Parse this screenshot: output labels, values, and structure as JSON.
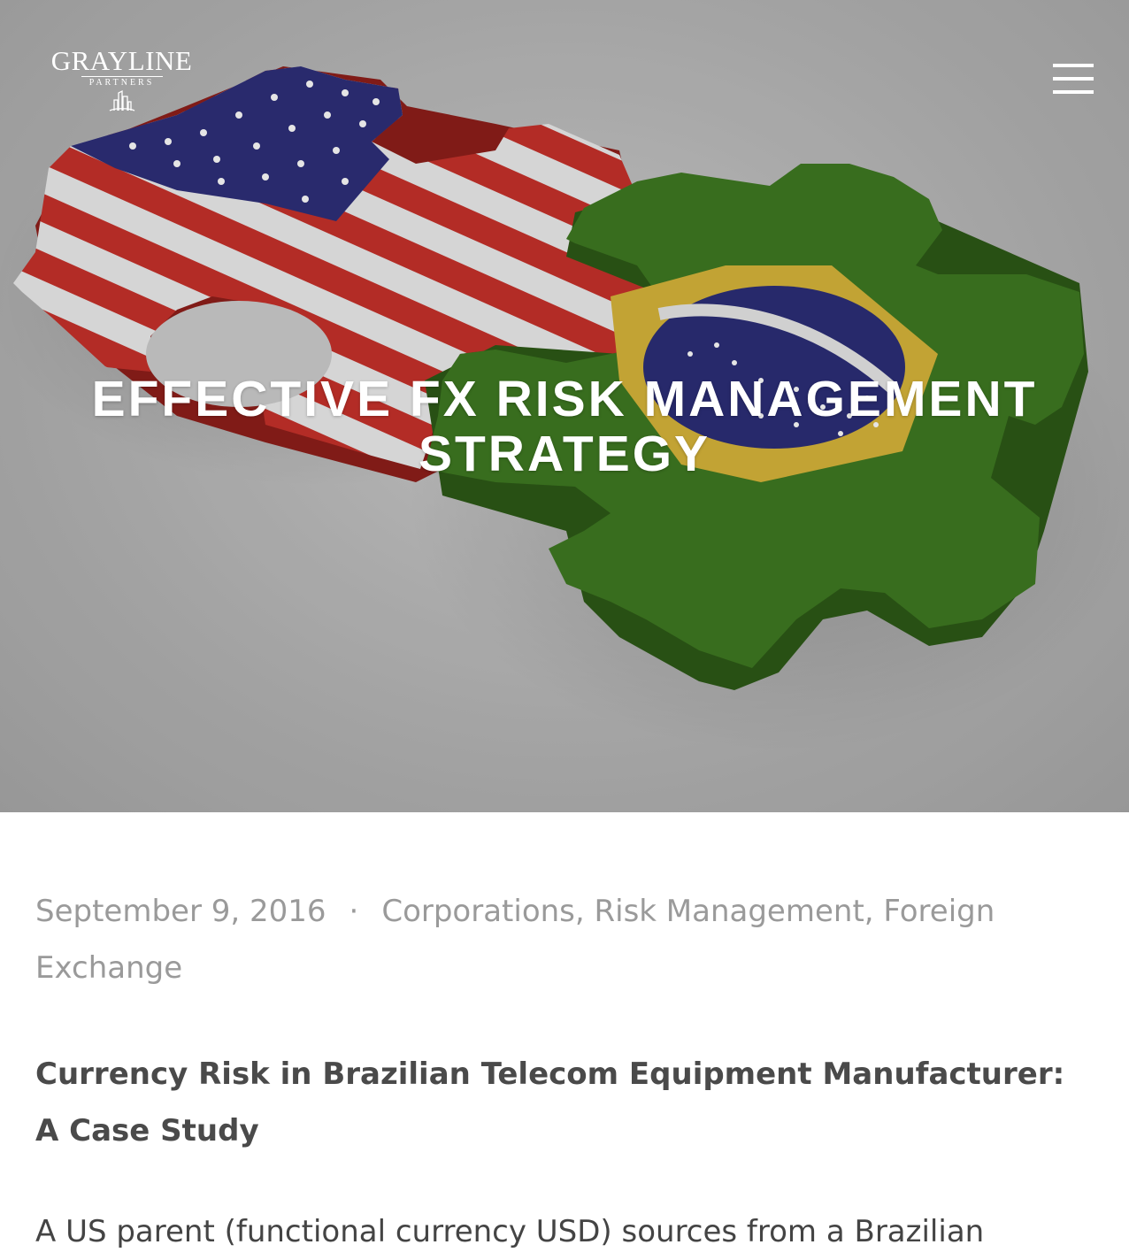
{
  "header": {
    "logo": {
      "name": "GRAYLINE",
      "tagline": "PARTNERS",
      "icon": "building-icon"
    },
    "menu_icon": "hamburger-menu-icon"
  },
  "hero": {
    "image": "usa-brazil-flag-puzzle-pieces",
    "title": "EFFECTIVE FX RISK MANAGEMENT STRATEGY"
  },
  "post": {
    "date": "September 9, 2016",
    "separator": "·",
    "categories": [
      "Corporations",
      "Risk Management",
      "Foreign Exchange"
    ],
    "category_separator": ", ",
    "heading": "Currency Risk in Brazilian Telecom Equipment Manufacturer: A Case Study",
    "body_first_line": "A US parent (functional currency USD) sources from a Brazilian"
  },
  "colors": {
    "meta_text": "#9a9a9a",
    "heading_text": "#4a4a4a",
    "usa_red": "#c8322b",
    "usa_blue": "#2e2f7a",
    "brazil_green": "#3f7a22",
    "brazil_yellow": "#d9b63a"
  }
}
